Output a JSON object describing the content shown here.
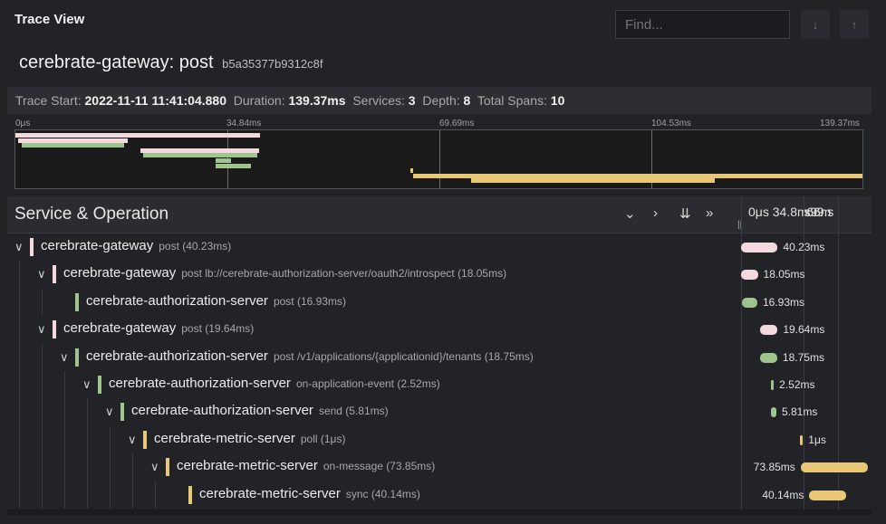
{
  "header": {
    "view_title": "Trace View",
    "find_placeholder": "Find...",
    "prev_icon": "arrow-down",
    "next_icon": "arrow-up"
  },
  "trace": {
    "service": "cerebrate-gateway: post",
    "trace_id": "b5a35377b9312c8f"
  },
  "summary": {
    "start_label": "Trace Start:",
    "start_value": "2022-11-11 11:41:04.880",
    "duration_label": "Duration:",
    "duration_value": "139.37ms",
    "services_label": "Services:",
    "services_value": "3",
    "depth_label": "Depth:",
    "depth_value": "8",
    "spans_label": "Total Spans:",
    "spans_value": "10"
  },
  "minimap_ticks": [
    "0μs",
    "34.84ms",
    "69.69ms",
    "104.53ms",
    "139.37ms"
  ],
  "list_header": {
    "title": "Service & Operation",
    "timeline_ticks": "0μs  34.8",
    "timeline_overlap": "ms 69.69ms"
  },
  "colors": {
    "gateway": "#f3d9de",
    "auth": "#9fc48e",
    "metric": "#e8c777"
  },
  "spans": [
    {
      "service": "cerebrate-gateway",
      "operation": "post (40.23ms)",
      "duration": "40.23ms",
      "start_ms": 0,
      "dur_ms": 40.23,
      "color": "gateway"
    },
    {
      "service": "cerebrate-gateway",
      "operation": "post lb://cerebrate-authorization-server/oauth2/introspect (18.05ms)",
      "duration": "18.05ms",
      "start_ms": 0.4,
      "dur_ms": 18.05,
      "color": "gateway"
    },
    {
      "service": "cerebrate-authorization-server",
      "operation": "post (16.93ms)",
      "duration": "16.93ms",
      "start_ms": 1.0,
      "dur_ms": 16.93,
      "color": "auth"
    },
    {
      "service": "cerebrate-gateway",
      "operation": "post (19.64ms)",
      "duration": "19.64ms",
      "start_ms": 20.5,
      "dur_ms": 19.64,
      "color": "gateway"
    },
    {
      "service": "cerebrate-authorization-server",
      "operation": "post /v1/applications/{applicationid}/tenants (18.75ms)",
      "duration": "18.75ms",
      "start_ms": 21.0,
      "dur_ms": 18.75,
      "color": "auth"
    },
    {
      "service": "cerebrate-authorization-server",
      "operation": "on-application-event (2.52ms)",
      "duration": "2.52ms",
      "start_ms": 33.0,
      "dur_ms": 2.52,
      "color": "auth"
    },
    {
      "service": "cerebrate-authorization-server",
      "operation": "send (5.81ms)",
      "duration": "5.81ms",
      "start_ms": 33.0,
      "dur_ms": 5.81,
      "color": "auth"
    },
    {
      "service": "cerebrate-metric-server",
      "operation": "poll (1μs)",
      "duration": "1μs",
      "start_ms": 65.0,
      "dur_ms": 0.4,
      "color": "metric"
    },
    {
      "service": "cerebrate-metric-server",
      "operation": "on-message (73.85ms)",
      "duration": "73.85ms",
      "start_ms": 65.5,
      "dur_ms": 73.85,
      "color": "metric"
    },
    {
      "service": "cerebrate-metric-server",
      "operation": "sync (40.14ms)",
      "duration": "40.14ms",
      "start_ms": 75.0,
      "dur_ms": 40.14,
      "color": "metric"
    }
  ]
}
